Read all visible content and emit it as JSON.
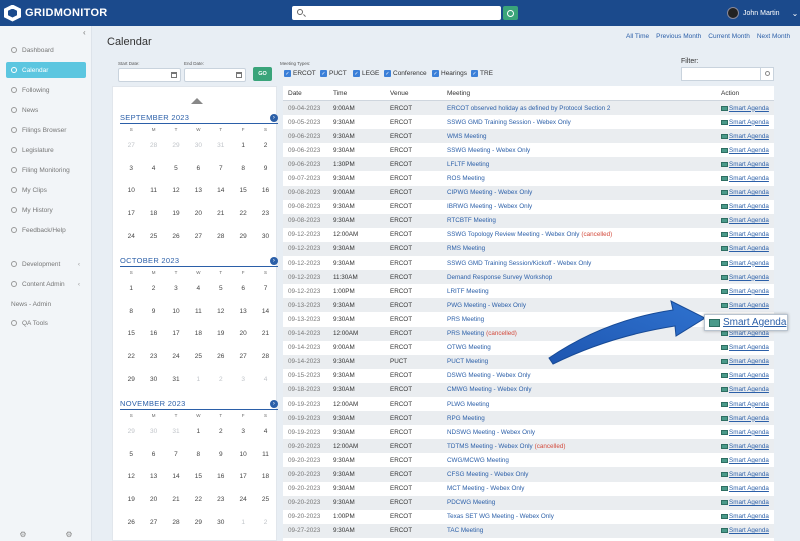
{
  "app": {
    "name": "GRIDMONITOR",
    "user": "John Martin"
  },
  "sidebar": {
    "items": [
      {
        "label": "Dashboard",
        "name": "sidebar-item-dashboard"
      },
      {
        "label": "Calendar",
        "name": "sidebar-item-calendar",
        "active": true
      },
      {
        "label": "Following",
        "name": "sidebar-item-following"
      },
      {
        "label": "News",
        "name": "sidebar-item-news"
      },
      {
        "label": "Filings Browser",
        "name": "sidebar-item-filings-browser"
      },
      {
        "label": "Legislature",
        "name": "sidebar-item-legislature"
      },
      {
        "label": "Filing Monitoring",
        "name": "sidebar-item-filing-monitoring"
      },
      {
        "label": "My Clips",
        "name": "sidebar-item-my-clips"
      },
      {
        "label": "My History",
        "name": "sidebar-item-my-history"
      },
      {
        "label": "Feedback/Help",
        "name": "sidebar-item-feedback-help"
      },
      {
        "label": "Development",
        "name": "sidebar-item-development"
      },
      {
        "label": "Content Admin",
        "name": "sidebar-item-content-admin"
      },
      {
        "label": "News - Admin",
        "name": "sidebar-item-news-admin"
      },
      {
        "label": "QA Tools",
        "name": "sidebar-item-qa-tools"
      }
    ]
  },
  "page": {
    "title": "Calendar"
  },
  "range_links": [
    "All Time",
    "Previous Month",
    "Current Month",
    "Next Month"
  ],
  "filters": {
    "start_label": "Start Date:",
    "end_label": "End Date:",
    "go": "GO",
    "meeting_types_label": "Meeting Types:",
    "types": [
      "ERCOT",
      "PUCT",
      "LEGE",
      "Conference",
      "Hearings",
      "TRE"
    ],
    "filter_label": "Filter:"
  },
  "calendar": {
    "dow": [
      "S",
      "M",
      "T",
      "W",
      "T",
      "F",
      "S"
    ],
    "months": [
      {
        "title": "SEPTEMBER 2023",
        "days": [
          "27",
          "28",
          "29",
          "30",
          "31",
          "1",
          "2",
          "3",
          "4",
          "5",
          "6",
          "7",
          "8",
          "9",
          "10",
          "11",
          "12",
          "13",
          "14",
          "15",
          "16",
          "17",
          "18",
          "19",
          "20",
          "21",
          "22",
          "23",
          "24",
          "25",
          "26",
          "27",
          "28",
          "29",
          "30"
        ],
        "outside": [
          0,
          1,
          2,
          3,
          4
        ]
      },
      {
        "title": "OCTOBER 2023",
        "days": [
          "1",
          "2",
          "3",
          "4",
          "5",
          "6",
          "7",
          "8",
          "9",
          "10",
          "11",
          "12",
          "13",
          "14",
          "15",
          "16",
          "17",
          "18",
          "19",
          "20",
          "21",
          "22",
          "23",
          "24",
          "25",
          "26",
          "27",
          "28",
          "29",
          "30",
          "31",
          "1",
          "2",
          "3",
          "4"
        ],
        "outside": [
          31,
          32,
          33,
          34
        ]
      },
      {
        "title": "NOVEMBER 2023",
        "days": [
          "29",
          "30",
          "31",
          "1",
          "2",
          "3",
          "4",
          "5",
          "6",
          "7",
          "8",
          "9",
          "10",
          "11",
          "12",
          "13",
          "14",
          "15",
          "16",
          "17",
          "18",
          "19",
          "20",
          "21",
          "22",
          "23",
          "24",
          "25",
          "26",
          "27",
          "28",
          "29",
          "30",
          "1",
          "2"
        ],
        "outside": [
          0,
          1,
          2,
          33,
          34
        ]
      }
    ]
  },
  "table": {
    "headers": [
      "Date",
      "Time",
      "Venue",
      "Meeting",
      "Action"
    ],
    "action_label": "Smart Agenda",
    "cancelled_label": "(cancelled)",
    "rows": [
      {
        "date": "09-04-2023",
        "time": "9:00AM",
        "venue": "ERCOT",
        "meeting": "ERCOT observed holiday as defined by Protocol Section 2"
      },
      {
        "date": "09-05-2023",
        "time": "9:30AM",
        "venue": "ERCOT",
        "meeting": "SSWG GMD Training Session - Webex Only"
      },
      {
        "date": "09-06-2023",
        "time": "9:30AM",
        "venue": "ERCOT",
        "meeting": "WMS Meeting"
      },
      {
        "date": "09-06-2023",
        "time": "9:30AM",
        "venue": "ERCOT",
        "meeting": "SSWG Meeting - Webex Only"
      },
      {
        "date": "09-06-2023",
        "time": "1:30PM",
        "venue": "ERCOT",
        "meeting": "LFLTF Meeting"
      },
      {
        "date": "09-07-2023",
        "time": "9:30AM",
        "venue": "ERCOT",
        "meeting": "ROS Meeting"
      },
      {
        "date": "09-08-2023",
        "time": "9:00AM",
        "venue": "ERCOT",
        "meeting": "CIPWG Meeting - Webex Only"
      },
      {
        "date": "09-08-2023",
        "time": "9:30AM",
        "venue": "ERCOT",
        "meeting": "IBRWG Meeting - Webex Only"
      },
      {
        "date": "09-08-2023",
        "time": "9:30AM",
        "venue": "ERCOT",
        "meeting": "RTCBTF Meeting"
      },
      {
        "date": "09-12-2023",
        "time": "12:00AM",
        "venue": "ERCOT",
        "meeting": "SSWG Topology Review Meeting - Webex Only",
        "cancelled": true
      },
      {
        "date": "09-12-2023",
        "time": "9:30AM",
        "venue": "ERCOT",
        "meeting": "RMS Meeting"
      },
      {
        "date": "09-12-2023",
        "time": "9:30AM",
        "venue": "ERCOT",
        "meeting": "SSWG GMD Training Session/Kickoff - Webex Only"
      },
      {
        "date": "09-12-2023",
        "time": "11:30AM",
        "venue": "ERCOT",
        "meeting": "Demand Response Survey Workshop"
      },
      {
        "date": "09-12-2023",
        "time": "1:00PM",
        "venue": "ERCOT",
        "meeting": "LRITF Meeting"
      },
      {
        "date": "09-13-2023",
        "time": "9:30AM",
        "venue": "ERCOT",
        "meeting": "PWG Meeting - Webex Only"
      },
      {
        "date": "09-13-2023",
        "time": "9:30AM",
        "venue": "ERCOT",
        "meeting": "PRS Meeting"
      },
      {
        "date": "09-14-2023",
        "time": "12:00AM",
        "venue": "ERCOT",
        "meeting": "PRS Meeting",
        "cancelled": true
      },
      {
        "date": "09-14-2023",
        "time": "9:00AM",
        "venue": "ERCOT",
        "meeting": "OTWG Meeting"
      },
      {
        "date": "09-14-2023",
        "time": "9:30AM",
        "venue": "PUCT",
        "meeting": "PUCT Meeting"
      },
      {
        "date": "09-15-2023",
        "time": "9:30AM",
        "venue": "ERCOT",
        "meeting": "DSWG Meeting - Webex Only"
      },
      {
        "date": "09-18-2023",
        "time": "9:30AM",
        "venue": "ERCOT",
        "meeting": "CMWG Meeting - Webex Only"
      },
      {
        "date": "09-19-2023",
        "time": "12:00AM",
        "venue": "ERCOT",
        "meeting": "PLWG Meeting"
      },
      {
        "date": "09-19-2023",
        "time": "9:30AM",
        "venue": "ERCOT",
        "meeting": "RPG Meeting"
      },
      {
        "date": "09-19-2023",
        "time": "9:30AM",
        "venue": "ERCOT",
        "meeting": "NDSWG Meeting - Webex Only"
      },
      {
        "date": "09-20-2023",
        "time": "12:00AM",
        "venue": "ERCOT",
        "meeting": "TDTMS Meeting - Webex Only",
        "cancelled": true
      },
      {
        "date": "09-20-2023",
        "time": "9:30AM",
        "venue": "ERCOT",
        "meeting": "CWG/MCWG Meeting"
      },
      {
        "date": "09-20-2023",
        "time": "9:30AM",
        "venue": "ERCOT",
        "meeting": "CFSG Meeting - Webex Only"
      },
      {
        "date": "09-20-2023",
        "time": "9:30AM",
        "venue": "ERCOT",
        "meeting": "MCT Meeting - Webex Only"
      },
      {
        "date": "09-20-2023",
        "time": "9:30AM",
        "venue": "ERCOT",
        "meeting": "PDCWG Meeting"
      },
      {
        "date": "09-20-2023",
        "time": "1:00PM",
        "venue": "ERCOT",
        "meeting": "Texas SET WG Meeting - Webex Only"
      },
      {
        "date": "09-27-2023",
        "time": "9:30AM",
        "venue": "ERCOT",
        "meeting": "TAC Meeting"
      }
    ]
  },
  "callout": {
    "label": "Smart Agenda"
  }
}
